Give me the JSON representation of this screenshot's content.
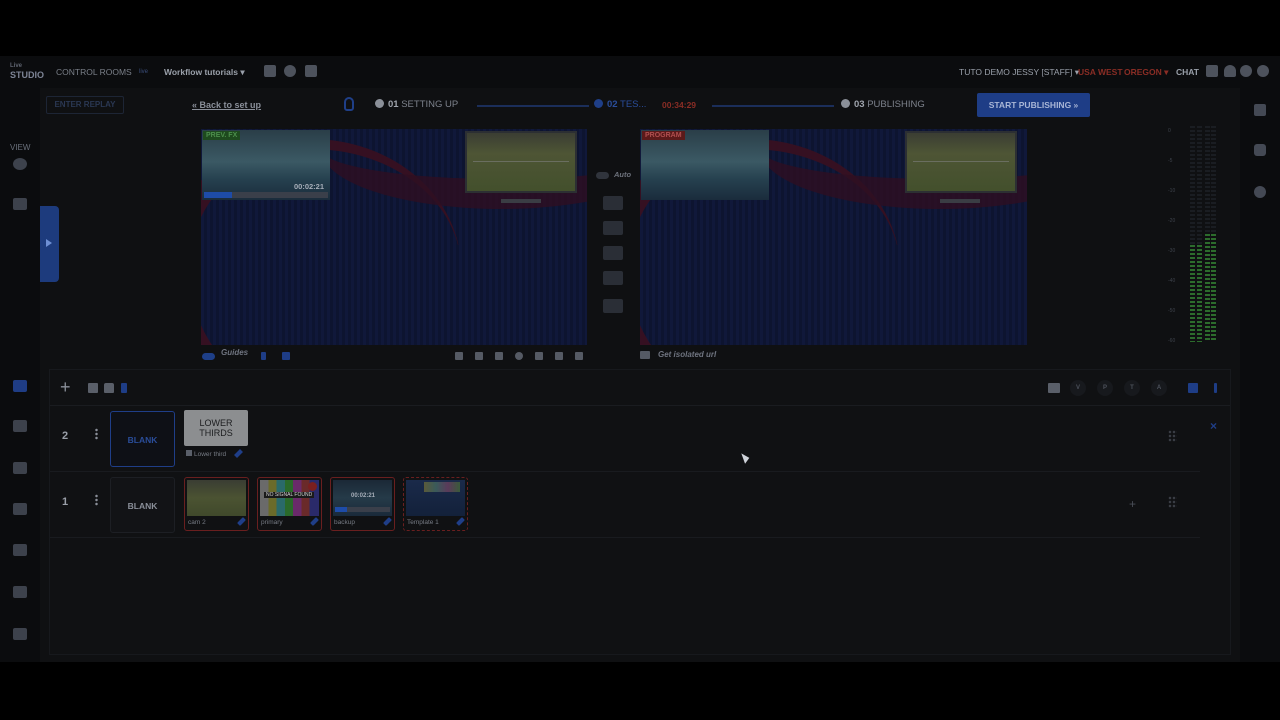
{
  "topbar": {
    "logo_small": "Live",
    "logo_main": "STUDIO",
    "control_rooms": "CONTROL ROOMS",
    "live_badge": "live",
    "workflow": "Workflow tutorials",
    "user": "TUTO DEMO JESSY [STAFF]",
    "region": "USA WEST",
    "zone": "OREGON",
    "chat": "CHAT"
  },
  "leftnav": {
    "view_label": "VIEW"
  },
  "steps": {
    "enter_replay": "ENTER REPLAY",
    "back_link": "Back to set up",
    "step1_num": "01",
    "step1_label": "SETTING UP",
    "step2_num": "02",
    "step2_label": "TES...",
    "timer": "00:34:29",
    "step3_num": "03",
    "step3_label": "PUBLISHING",
    "start_button": "START PUBLISHING"
  },
  "preview": {
    "label": "PREV. FX",
    "time": "00:02:21",
    "guides": "Guides",
    "auto": "Auto"
  },
  "program": {
    "label": "PROGRAM",
    "isolated": "Get isolated url"
  },
  "meter": {
    "ticks": [
      "0",
      "-5",
      "-10",
      "-20",
      "-30",
      "-40",
      "-50",
      "-60"
    ],
    "level_left": 0.45,
    "level_right": 0.5
  },
  "toolbar_letters": [
    "V",
    "P",
    "T",
    "A"
  ],
  "layers": [
    {
      "number": "2",
      "blank": "BLANK",
      "lower_title": "LOWER\nTHIRDS",
      "lower_caption": "Lower third"
    },
    {
      "number": "1",
      "blank": "BLANK",
      "clips": [
        {
          "caption": "cam 2"
        },
        {
          "caption": "primary",
          "overlay": "NO SIGNAL FOUND"
        },
        {
          "caption": "backup",
          "time": "00:02:21"
        },
        {
          "caption": "Template 1"
        }
      ]
    }
  ],
  "colors": {
    "accent": "#1e3d86",
    "danger": "#8a2d25",
    "meter_green": "#2c6c2c"
  }
}
